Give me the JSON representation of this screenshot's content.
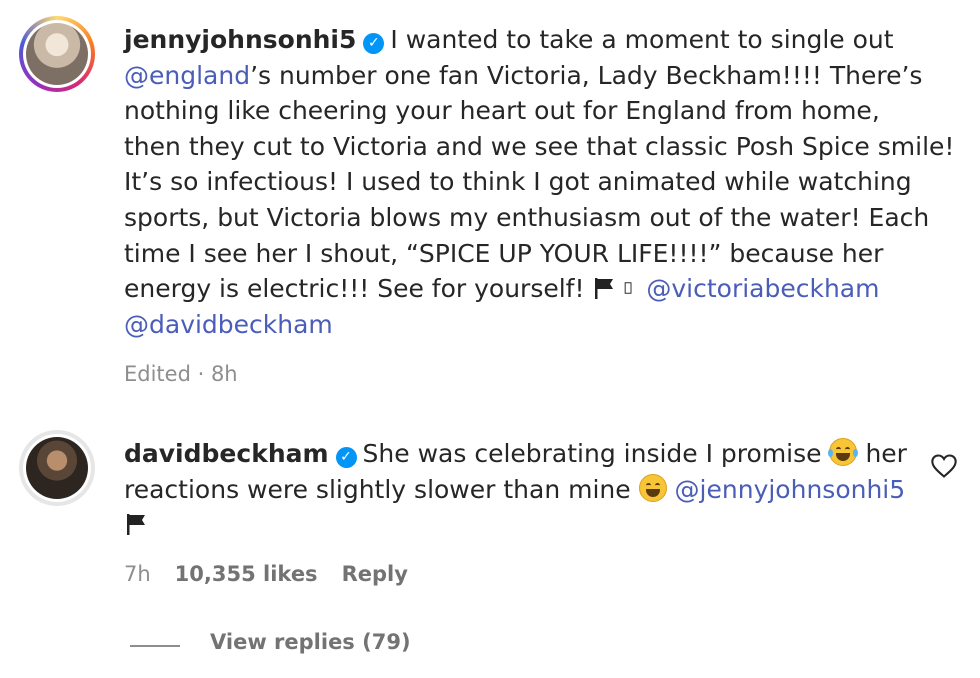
{
  "comments": [
    {
      "username": "jennyjohnsonhi5",
      "text_1": "I wanted to take a moment to single out",
      "mention_1": "@england",
      "text_2": "’s number one fan Victoria, Lady Beckham!!!! There’s",
      "line_3": "nothing like cheering your heart out for England from home,",
      "line_4": "then they cut to Victoria and we see that classic Posh Spice smile!",
      "line_5": "It’s so infectious! I used to think I got animated while watching",
      "line_6": "sports, but Victoria blows my enthusiasm out of the water! Each",
      "line_7": "time I see her I shout, “SPICE UP YOUR LIFE!!!!” because her",
      "line_8": "energy is electric!!! See for yourself!",
      "mention_2": "@victoriabeckham",
      "mention_3": "@davidbeckham",
      "meta": "Edited · 8h"
    },
    {
      "username": "davidbeckham",
      "text_1": "She was celebrating inside I promise",
      "text_2": "her",
      "line_2": "reactions were slightly slower than mine",
      "mention_1": "@jennyjohnsonhi5",
      "time": "7h",
      "likes": "10,355 likes",
      "reply": "Reply"
    }
  ],
  "view_replies": "View replies (79)",
  "icons": {
    "verified": "verified-badge-icon",
    "flag": "black-flag-icon",
    "heart": "heart-outline-icon"
  },
  "colors": {
    "mention": "#4a5db8",
    "verified": "#0095f6",
    "meta": "#8e8e8e"
  }
}
